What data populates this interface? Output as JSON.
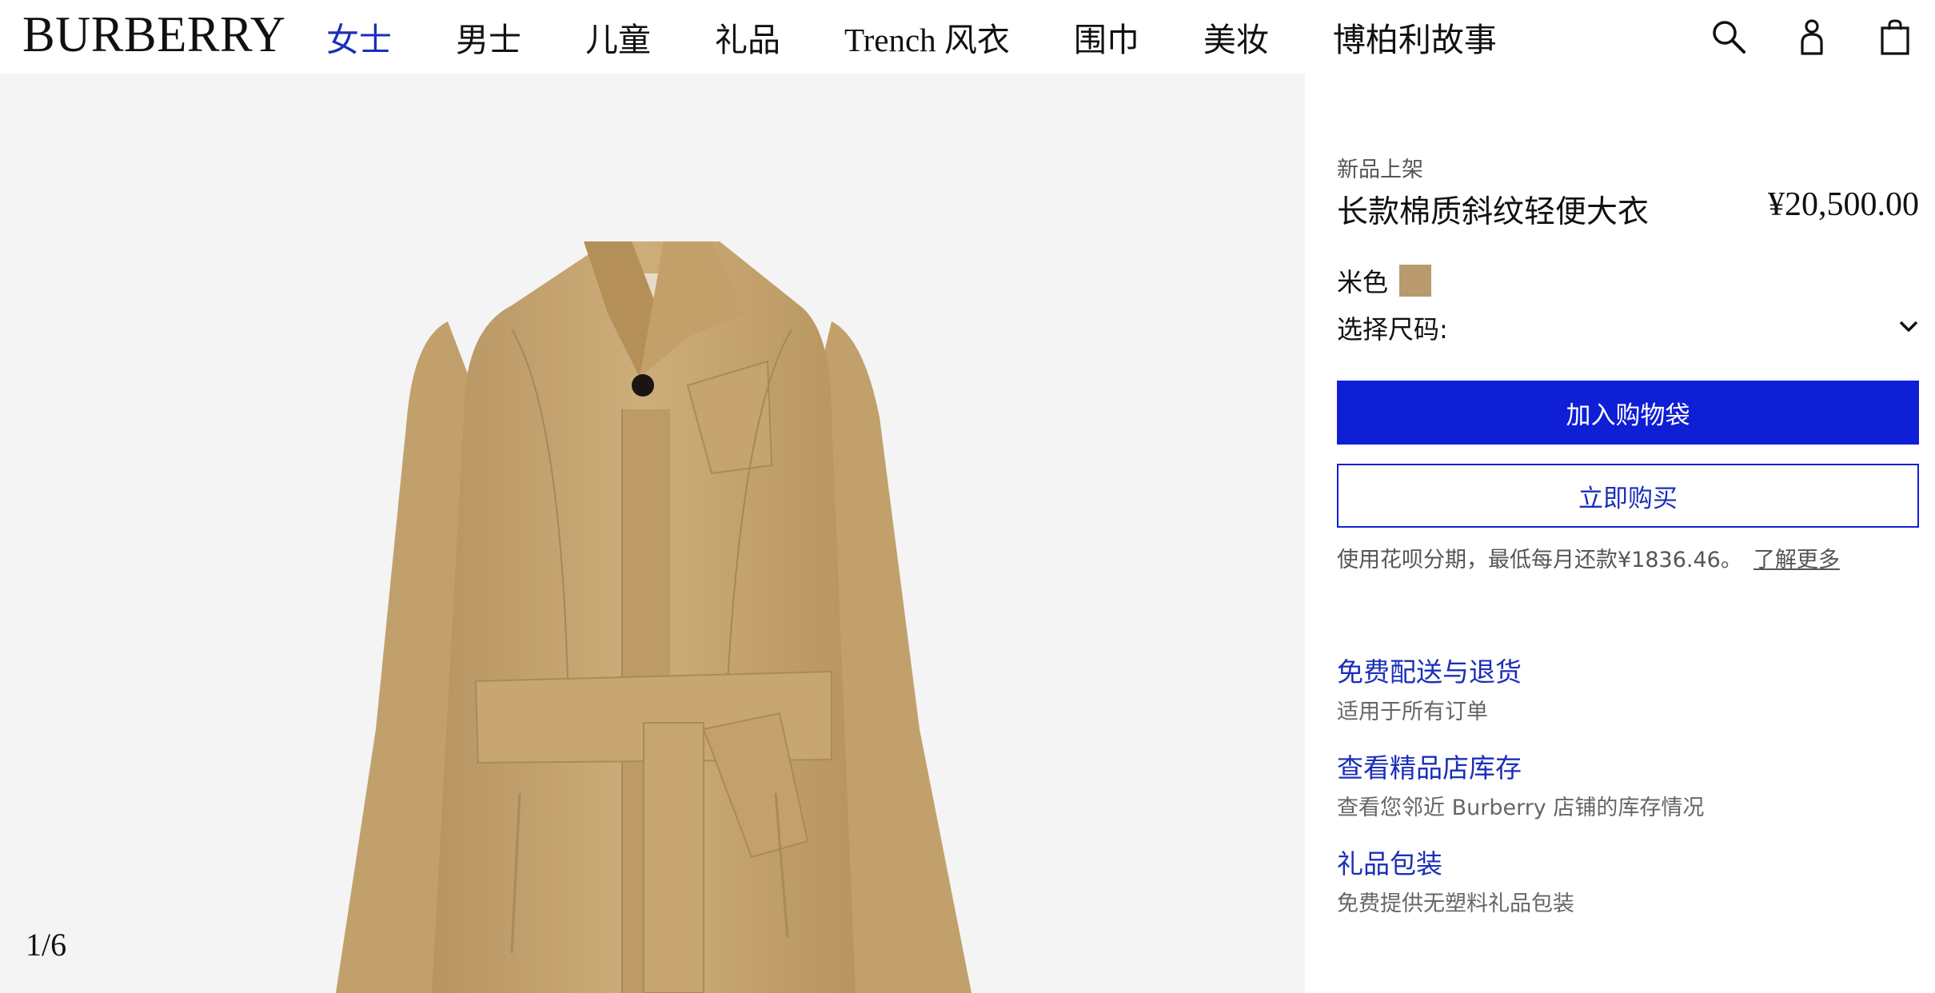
{
  "brand": "BURBERRY",
  "nav": {
    "items": [
      "女士",
      "男士",
      "儿童",
      "礼品",
      "Trench 风衣",
      "围巾",
      "美妆",
      "博柏利故事"
    ],
    "active_index": 0
  },
  "header_icons": [
    "search-icon",
    "account-icon",
    "shopping-bag-icon"
  ],
  "gallery": {
    "counter": "1/6",
    "current": 1,
    "total": 6
  },
  "product": {
    "tag": "新品上架",
    "name": "长款棉质斜纹轻便大衣",
    "price": "¥20,500.00",
    "color_label": "米色",
    "size_label": "选择尺码:",
    "add_to_bag": "加入购物袋",
    "buy_now": "立即购买",
    "installment_text": "使用花呗分期，最低每月还款¥1836.46。",
    "learn_more": "了解更多"
  },
  "services": [
    {
      "title": "免费配送与退货",
      "desc": "适用于所有订单"
    },
    {
      "title": "查看精品店库存",
      "desc": "查看您邻近 Burberry 店铺的库存情况"
    },
    {
      "title": "礼品包装",
      "desc": "免费提供无塑料礼品包装"
    }
  ],
  "colors": {
    "accent": "#0f1fd6",
    "accent_text": "#1a2fb9",
    "swatch": "#b89a6e",
    "coat": "#c9a874",
    "gallery_bg": "#f4f4f4"
  }
}
